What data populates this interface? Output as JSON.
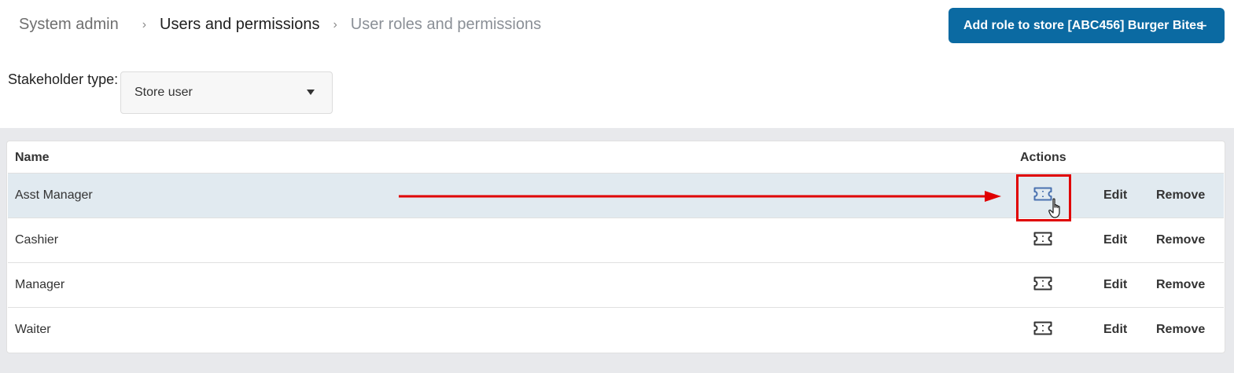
{
  "breadcrumb": {
    "items": [
      "System admin",
      "Users and permissions",
      "User roles and permissions"
    ]
  },
  "add_button": {
    "label": "Add role to store [ABC456] Burger Bites",
    "icon": "plus-icon"
  },
  "filter": {
    "label": "Stakeholder type:",
    "value": "Store user"
  },
  "table": {
    "columns": [
      "Name",
      "Actions"
    ],
    "rows": [
      {
        "name": "Asst Manager",
        "edit": "Edit",
        "remove": "Remove"
      },
      {
        "name": "Cashier",
        "edit": "Edit",
        "remove": "Remove"
      },
      {
        "name": "Manager",
        "edit": "Edit",
        "remove": "Remove"
      },
      {
        "name": "Waiter",
        "edit": "Edit",
        "remove": "Remove"
      }
    ]
  },
  "colors": {
    "primary": "#0b6aa2",
    "highlight_row": "#e1eaf0",
    "annotation": "#e00000"
  }
}
